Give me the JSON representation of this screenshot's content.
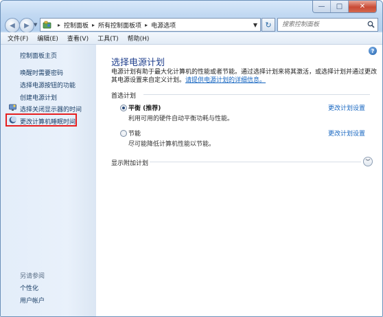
{
  "window": {
    "minimize_glyph": "—",
    "maximize_glyph": "□",
    "close_glyph": "✕"
  },
  "address_bar": {
    "crumbs": [
      "控制面板",
      "所有控制面板项",
      "电源选项"
    ]
  },
  "search": {
    "placeholder": "搜索控制面板"
  },
  "menu": {
    "file": "文件(F)",
    "edit": "编辑(E)",
    "view": "查看(V)",
    "tools": "工具(T)",
    "help": "帮助(H)"
  },
  "sidebar": {
    "home": "控制面板主页",
    "items": [
      {
        "label": "唤醒时需要密码",
        "icon": "none"
      },
      {
        "label": "选择电源按钮的功能",
        "icon": "none"
      },
      {
        "label": "创建电源计划",
        "icon": "none"
      },
      {
        "label": "选择关闭显示器的时间",
        "icon": "display-icon"
      },
      {
        "label": "更改计算机睡眠时间",
        "icon": "moon-icon"
      }
    ],
    "see_also_title": "另请参阅",
    "see_also": [
      "个性化",
      "用户帐户"
    ]
  },
  "main": {
    "title": "选择电源计划",
    "description": "电源计划有助于最大化计算机的性能或者节能。通过选择计划来将其激活，或选择计划并通过更改其电源设置来自定义计划。",
    "link": "请提供电源计划的详细信息。",
    "preferred_plans": "首选计划",
    "plans": [
      {
        "name": "平衡 (推荐)",
        "description": "利用可用的硬件自动平衡功耗与性能。",
        "selected": true,
        "change_link": "更改计划设置"
      },
      {
        "name": "节能",
        "description": "尽可能降低计算机性能以节能。",
        "selected": false,
        "change_link": "更改计划设置"
      }
    ],
    "show_more": "显示附加计划"
  },
  "colors": {
    "highlight_box": "#e61e1e",
    "link": "#1565c0",
    "title": "#1e3e8c"
  }
}
